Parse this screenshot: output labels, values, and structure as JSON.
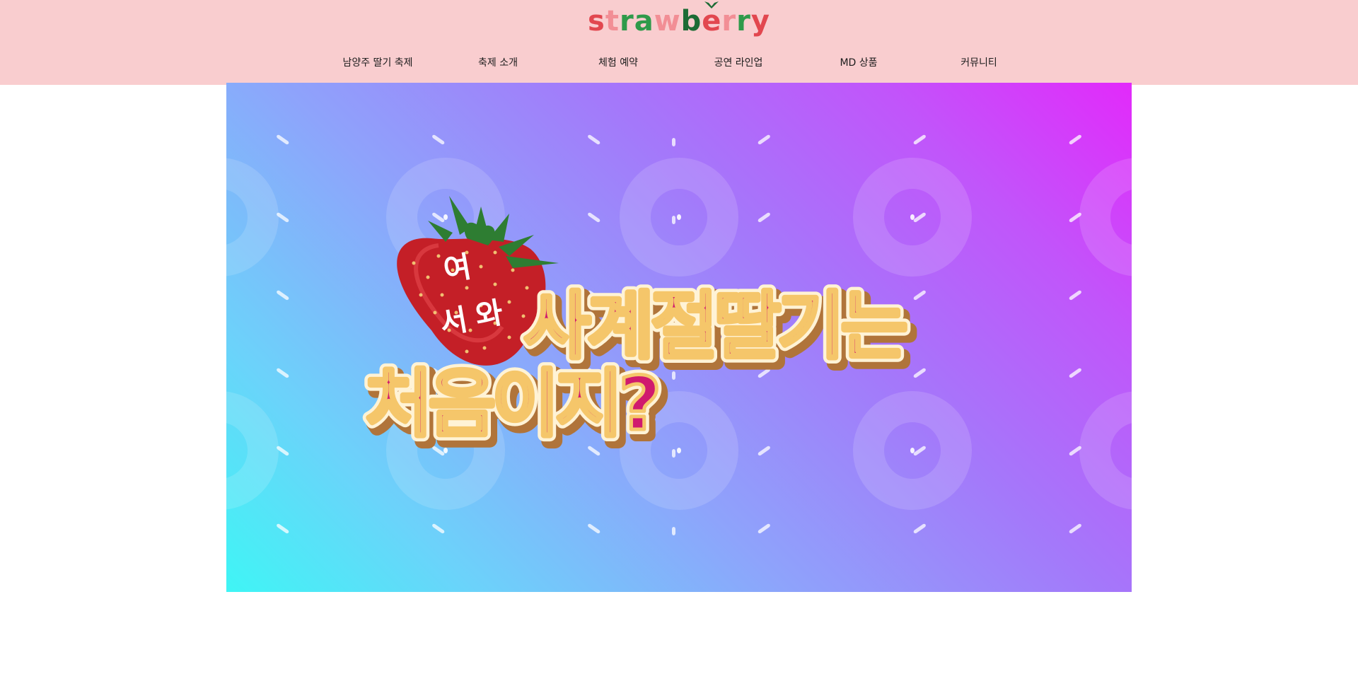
{
  "header": {
    "logo": {
      "letters": [
        {
          "ch": "s",
          "color": "#e2474f"
        },
        {
          "ch": "t",
          "color": "#f28e95"
        },
        {
          "ch": "r",
          "color": "#2f9a4a"
        },
        {
          "ch": "a",
          "color": "#2f9a4a"
        },
        {
          "ch": "w",
          "color": "#f28e95"
        },
        {
          "ch": "b",
          "color": "#1d6b35"
        },
        {
          "ch": "e",
          "color": "#e2474f"
        },
        {
          "ch": "r",
          "color": "#f28e95"
        },
        {
          "ch": "r",
          "color": "#2f9a4a"
        },
        {
          "ch": "y",
          "color": "#e2474f"
        }
      ]
    },
    "nav": [
      {
        "label": "남양주 딸기 축제"
      },
      {
        "label": "축제 소개"
      },
      {
        "label": "체험 예약"
      },
      {
        "label": "공연 라인업"
      },
      {
        "label": "MD 상품"
      },
      {
        "label": "커뮤니티"
      }
    ]
  },
  "banner": {
    "handwritten": [
      "여",
      "와",
      "서"
    ],
    "headline_line1": "사계절딸기는",
    "headline_line2": "처음이지?",
    "colors": {
      "text_fill": "#d01a6e",
      "text_outline": "#f5c66a",
      "text_shadow": "#b0743a",
      "strawberry": "#c8202a",
      "leaf": "#2e7d32"
    },
    "icons": [
      "strawberry-icon",
      "ring-pattern",
      "dash-pattern"
    ]
  }
}
